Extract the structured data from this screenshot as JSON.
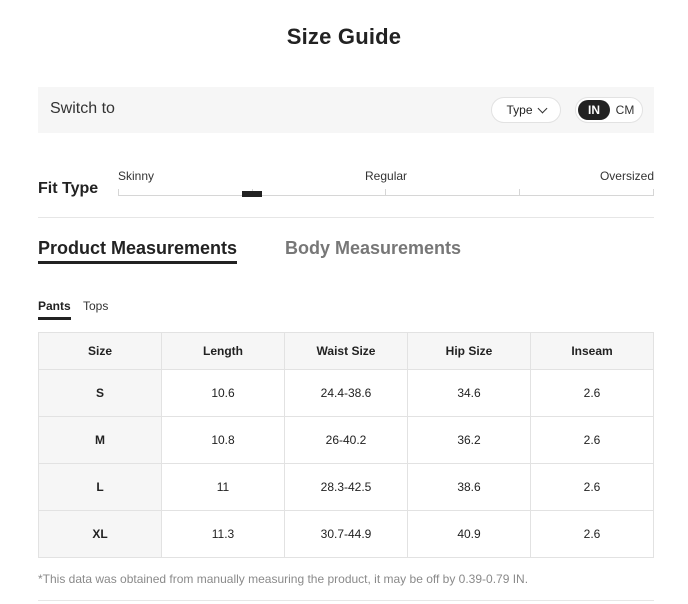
{
  "page": {
    "title": "Size Guide"
  },
  "switch_bar": {
    "label": "Switch to",
    "type_dropdown": {
      "label": "Type",
      "icon": "chevron-down-icon"
    },
    "units": {
      "active": "IN",
      "inactive": "CM"
    }
  },
  "fit_type": {
    "label": "Fit Type",
    "scale": {
      "left": "Skinny",
      "middle": "Regular",
      "right": "Oversized"
    },
    "position_fraction": 0.25
  },
  "tabs": {
    "product": "Product Measurements",
    "body": "Body Measurements",
    "active": "product"
  },
  "sub_tabs": {
    "pants": "Pants",
    "tops": "Tops",
    "active": "pants"
  },
  "table": {
    "headers": [
      "Size",
      "Length",
      "Waist Size",
      "Hip Size",
      "Inseam"
    ],
    "rows": [
      [
        "S",
        "10.6",
        "24.4-38.6",
        "34.6",
        "2.6"
      ],
      [
        "M",
        "10.8",
        "26-40.2",
        "36.2",
        "2.6"
      ],
      [
        "L",
        "11",
        "28.3-42.5",
        "38.6",
        "2.6"
      ],
      [
        "XL",
        "11.3",
        "30.7-44.9",
        "40.9",
        "2.6"
      ]
    ]
  },
  "note": "*This data was obtained from manually measuring the product, it may be off by 0.39-0.79 IN.",
  "colors": {
    "accent": "#222222",
    "panel_bg": "#f6f6f6",
    "border": "#e2e2e2",
    "muted_text": "#8a8a8a"
  }
}
